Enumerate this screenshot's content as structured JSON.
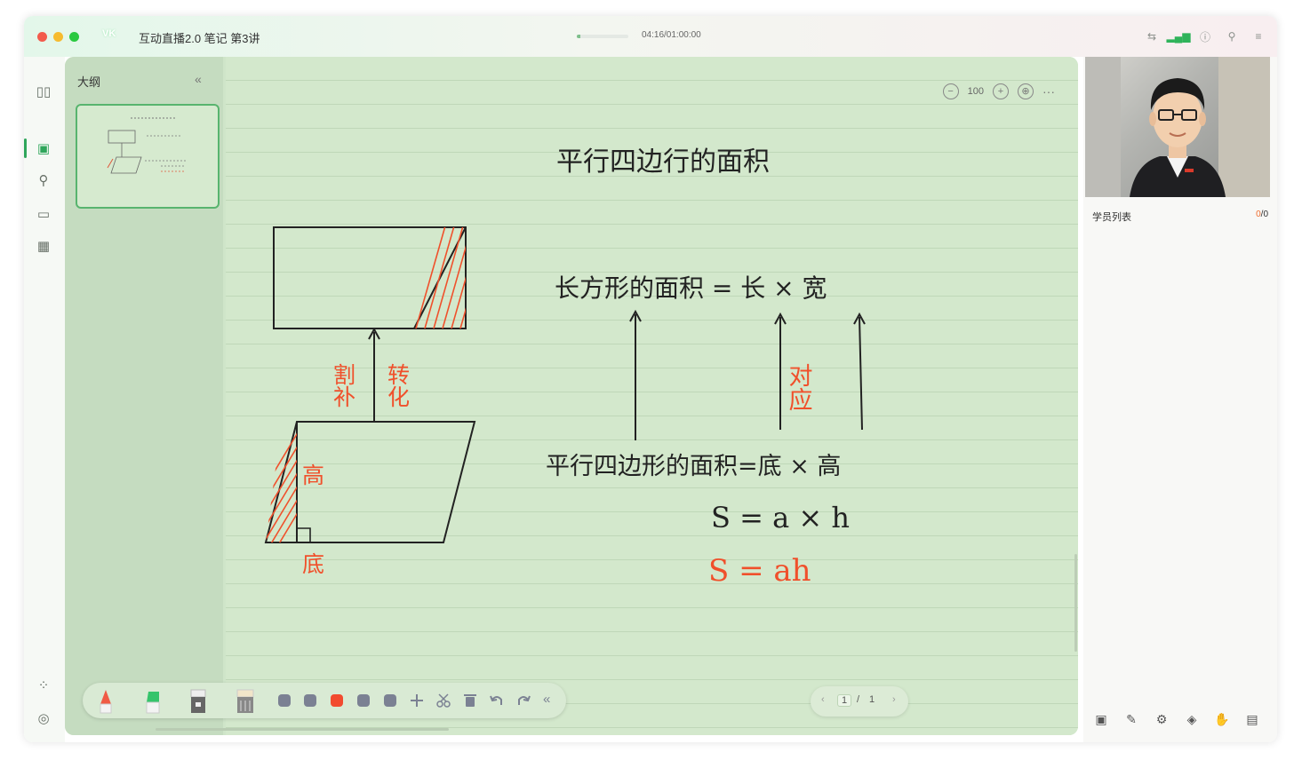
{
  "window": {
    "title": "互动直播2.0 笔记 第3讲",
    "logo_text": "VK",
    "timecode": "04:16/01:00:00",
    "progress_fraction": 0.07
  },
  "titlebar_icons": [
    "switch-icon",
    "signal-icon",
    "info-icon",
    "search-icon",
    "menu-icon"
  ],
  "leftnav": {
    "items": [
      "courseware-icon",
      "notes-icon",
      "search-user-icon",
      "monitor-icon",
      "grid-table-icon"
    ],
    "bottom": [
      "apps-icon",
      "settings-icon"
    ]
  },
  "outline": {
    "title": "大纲",
    "collapse": "«"
  },
  "board": {
    "zoom_value": "100",
    "zoom_out": "−",
    "zoom_in": "+",
    "more": "···",
    "texts": {
      "title": "平行四边行的面积",
      "rect_formula": "长方形的面积 = 长 × 宽",
      "para_formula": "平行四边形的面积=底 × 高",
      "formula_symbolic": "S = a × h",
      "formula_short": "S = ah",
      "label_cut_fill": "割补",
      "label_transform": "转化",
      "label_correspond": "对应",
      "label_height": "高",
      "label_base": "底"
    },
    "colors": {
      "ink": "#222222",
      "red_ink": "#f0502b"
    }
  },
  "toolbar": {
    "tools": [
      "pen-tool",
      "highlighter-tool",
      "eraser-tool",
      "ruler-tool",
      "text-tool",
      "shape-tool",
      "color-red",
      "image-tool",
      "screenshot-tool",
      "move-tool",
      "cut-tool",
      "delete-tool",
      "undo-tool",
      "redo-tool",
      "collapse-toolbar"
    ],
    "collapse": "«"
  },
  "pager": {
    "prev": "‹",
    "current": "1",
    "separator": "/",
    "total": "1",
    "next": "›"
  },
  "right_panel": {
    "student_list_label": "学员列表",
    "student_count_online": "0",
    "student_count_sep": "/",
    "student_count_total": "0",
    "bottom_icons": [
      "save-icon",
      "annotate-icon",
      "user-settings-icon",
      "fill-icon",
      "hand-raise-icon",
      "chat-icon"
    ]
  }
}
